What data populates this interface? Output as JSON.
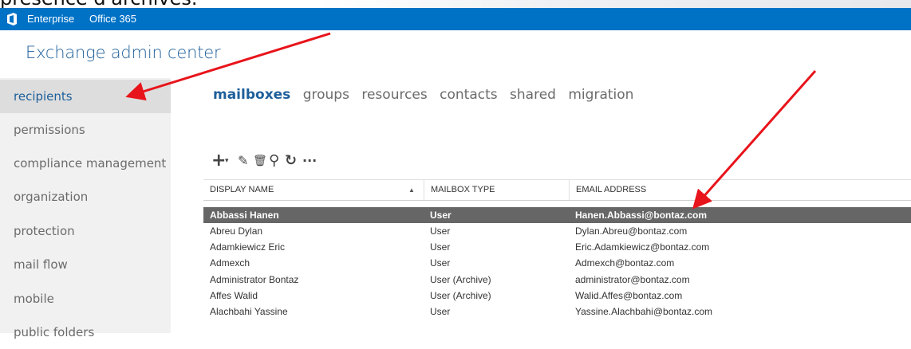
{
  "caption": "presence d'archives.",
  "topbar": {
    "nav": [
      "Enterprise",
      "Office 365"
    ]
  },
  "app_title": "Exchange admin center",
  "sidebar": {
    "items": [
      {
        "label": "recipients",
        "active": true
      },
      {
        "label": "permissions"
      },
      {
        "label": "compliance management"
      },
      {
        "label": "organization"
      },
      {
        "label": "protection"
      },
      {
        "label": "mail flow"
      },
      {
        "label": "mobile"
      },
      {
        "label": "public folders"
      }
    ]
  },
  "tabs": [
    {
      "label": "mailboxes",
      "active": true
    },
    {
      "label": "groups"
    },
    {
      "label": "resources"
    },
    {
      "label": "contacts"
    },
    {
      "label": "shared"
    },
    {
      "label": "migration"
    }
  ],
  "toolbar": {
    "add": "+",
    "add_dropdown": "▾",
    "edit": "✎",
    "delete": "🗑",
    "search": "⚲",
    "refresh": "↻",
    "more": "···"
  },
  "table": {
    "columns": [
      "DISPLAY NAME",
      "MAILBOX TYPE",
      "EMAIL ADDRESS"
    ],
    "rows": [
      {
        "name": "Abbassi Hanen",
        "type": "User",
        "email": "Hanen.Abbassi@bontaz.com",
        "selected": true
      },
      {
        "name": "Abreu Dylan",
        "type": "User",
        "email": "Dylan.Abreu@bontaz.com"
      },
      {
        "name": "Adamkiewicz Eric",
        "type": "User",
        "email": "Eric.Adamkiewicz@bontaz.com"
      },
      {
        "name": "Admexch",
        "type": "User",
        "email": "Admexch@bontaz.com"
      },
      {
        "name": "Administrator Bontaz",
        "type": "User (Archive)",
        "email": "administrator@bontaz.com"
      },
      {
        "name": "Affes Walid",
        "type": "User (Archive)",
        "email": "Walid.Affes@bontaz.com"
      },
      {
        "name": "Alachbahi Yassine",
        "type": "User",
        "email": "Yassine.Alachbahi@bontaz.com"
      }
    ]
  },
  "colors": {
    "topbar": "#0072c6",
    "accent_text": "#1e5f9a",
    "selected_row": "#666666",
    "annotation_arrow": "#e8141b"
  }
}
